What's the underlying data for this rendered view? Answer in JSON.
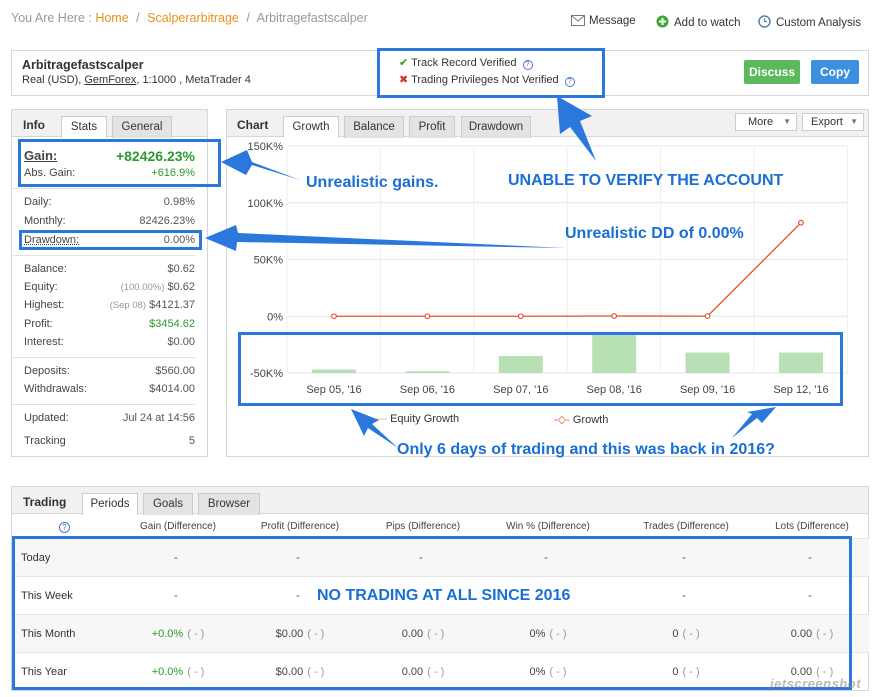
{
  "breadcrumb": {
    "prefix": "You Are Here :",
    "home": "Home",
    "category": "Scalperarbitrage",
    "current": "Arbitragefastscalper"
  },
  "toplinks": {
    "message": "Message",
    "watch": "Add to watch",
    "custom": "Custom Analysis"
  },
  "account": {
    "name": "Arbitragefastscalper",
    "sub_prefix": "Real (USD),",
    "broker": "GemForex",
    "sub_suffix": ", 1:1000 , MetaTrader 4",
    "track_record": "Track Record Verified",
    "privileges": "Trading Privileges Not Verified",
    "discuss": "Discuss",
    "copy": "Copy"
  },
  "info": {
    "title": "Info",
    "tabs": [
      "Stats",
      "General"
    ],
    "gain_label": "Gain:",
    "gain_value": "+82426.23%",
    "abs_gain_label": "Abs. Gain:",
    "abs_gain_value": "+616.9%",
    "daily_label": "Daily:",
    "daily_value": "0.98%",
    "monthly_label": "Monthly:",
    "monthly_value": "82426.23%",
    "drawdown_label": "Drawdown:",
    "drawdown_value": "0.00%",
    "balance_label": "Balance:",
    "balance_value": "$0.62",
    "equity_label": "Equity:",
    "equity_pct": "(100.00%)",
    "equity_value": "$0.62",
    "highest_label": "Highest:",
    "highest_date": "(Sep 08)",
    "highest_value": "$4121.37",
    "profit_label": "Profit:",
    "profit_value": "$3454.62",
    "interest_label": "Interest:",
    "interest_value": "$0.00",
    "deposits_label": "Deposits:",
    "deposits_value": "$560.00",
    "withdrawals_label": "Withdrawals:",
    "withdrawals_value": "$4014.00",
    "updated_label": "Updated:",
    "updated_value": "Jul 24 at 14:56",
    "tracking_label": "Tracking",
    "tracking_value": "5"
  },
  "chart_panel": {
    "title": "Chart",
    "tabs": [
      "Growth",
      "Balance",
      "Profit",
      "Drawdown"
    ],
    "more": "More",
    "export": "Export",
    "legend_equity": "Equity Growth",
    "legend_growth": "Growth"
  },
  "chart_data": {
    "type": "line",
    "categories": [
      "Sep 05, '16",
      "Sep 06, '16",
      "Sep 07, '16",
      "Sep 08, '16",
      "Sep 09, '16",
      "Sep 12, '16"
    ],
    "y_ticks": [
      "150K%",
      "100K%",
      "50K%",
      "0%",
      "-50K%"
    ],
    "ylim": [
      -50000,
      150000
    ],
    "series": [
      {
        "name": "Growth",
        "type": "line",
        "color": "#e0562c",
        "values": [
          0,
          0,
          0,
          200,
          100,
          82426
        ]
      },
      {
        "name": "Equity Growth",
        "type": "bar",
        "color": "#b8e0b5",
        "values": [
          -47000,
          -48500,
          -35000,
          -14000,
          -32000,
          -32000
        ]
      }
    ]
  },
  "annotations": {
    "unrealistic_gains": "Unrealistic gains.",
    "unable_verify": "UNABLE TO VERIFY THE ACCOUNT",
    "unrealistic_dd": "Unrealistic DD of 0.00%",
    "only_6_days": "Only 6 days of trading and this was back in 2016?",
    "no_trading": "NO TRADING AT ALL SINCE 2016"
  },
  "trading": {
    "title": "Trading",
    "tabs": [
      "Periods",
      "Goals",
      "Browser"
    ],
    "help": "?",
    "headers": [
      "Gain (Difference)",
      "Profit (Difference)",
      "Pips (Difference)",
      "Win % (Difference)",
      "Trades (Difference)",
      "Lots (Difference)"
    ],
    "rows": [
      {
        "label": "Today",
        "cells": [
          [
            "-",
            ""
          ],
          [
            "-",
            ""
          ],
          [
            "-",
            ""
          ],
          [
            "-",
            ""
          ],
          [
            "-",
            ""
          ],
          [
            "-",
            ""
          ]
        ]
      },
      {
        "label": "This Week",
        "cells": [
          [
            "-",
            ""
          ],
          [
            "-",
            ""
          ],
          [
            "",
            ""
          ],
          [
            "",
            ""
          ],
          [
            "-",
            ""
          ],
          [
            "-",
            ""
          ]
        ]
      },
      {
        "label": "This Month",
        "cells": [
          [
            "+0.0%",
            "( - )"
          ],
          [
            "$0.00",
            "( - )"
          ],
          [
            "0.00",
            "( - )"
          ],
          [
            "0%",
            "( - )"
          ],
          [
            "0",
            "( - )"
          ],
          [
            "0.00",
            "( - )"
          ]
        ]
      },
      {
        "label": "This Year",
        "cells": [
          [
            "+0.0%",
            "( - )"
          ],
          [
            "$0.00",
            "( - )"
          ],
          [
            "0.00",
            "( - )"
          ],
          [
            "0%",
            "( - )"
          ],
          [
            "0",
            "( - )"
          ],
          [
            "0.00",
            "( - )"
          ]
        ]
      }
    ]
  },
  "watermark": "jetscreenshot"
}
